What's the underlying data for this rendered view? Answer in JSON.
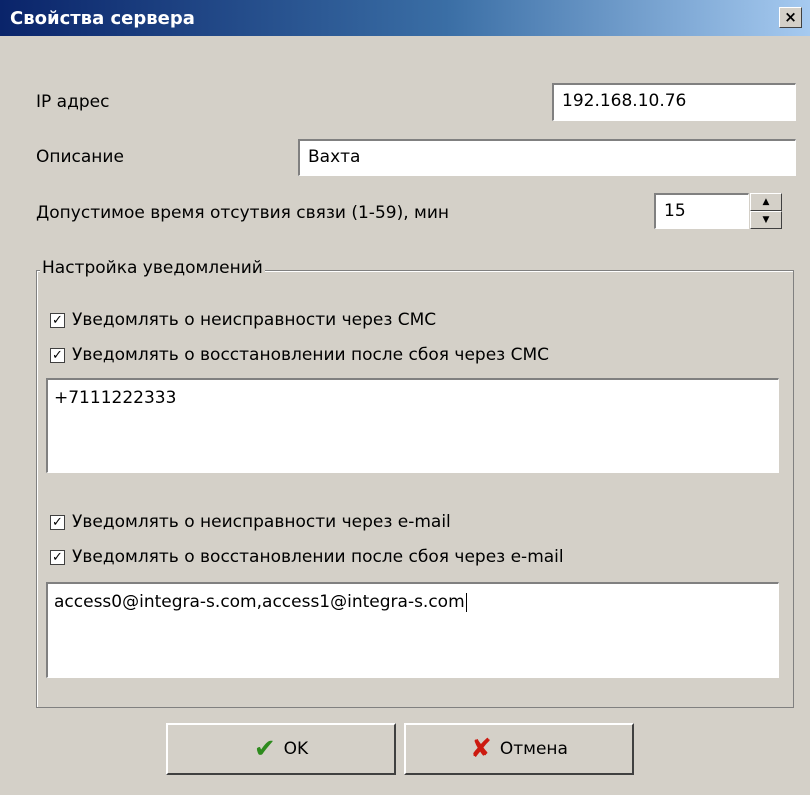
{
  "window": {
    "title": "Свойства сервера",
    "close_glyph": "×"
  },
  "fields": {
    "ip_label": "IP адрес",
    "ip_value": "192.168.10.76",
    "desc_label": "Описание",
    "desc_value": "Вахта",
    "timeout_label": "Допустимое время отсутвия связи (1-59), мин",
    "timeout_value": "15"
  },
  "notifications": {
    "group_title": "Настройка уведомлений",
    "sms_fault_label": "Уведомлять о неисправности через СМС",
    "sms_restore_label": "Уведомлять о восстановлении после сбоя через СМС",
    "sms_numbers": "+7111222333",
    "email_fault_label": "Уведомлять о неисправности через e-mail",
    "email_restore_label": "Уведомлять о восстановлении после сбоя через e-mail",
    "emails": "access0@integra-s.com,access1@integra-s.com",
    "checks": {
      "sms_fault": true,
      "sms_restore": true,
      "email_fault": true,
      "email_restore": true
    }
  },
  "buttons": {
    "ok_label": "OK",
    "cancel_label": "Отмена"
  },
  "icons": {
    "ok": "checkmark-icon",
    "cancel": "cross-icon",
    "spin_up": "arrow-up-icon",
    "spin_down": "arrow-down-icon"
  },
  "colors": {
    "titlebar_start": "#0a246a",
    "titlebar_end": "#a6caf0",
    "ok_icon": "#2e8b1e",
    "cancel_icon": "#cc1a10"
  }
}
